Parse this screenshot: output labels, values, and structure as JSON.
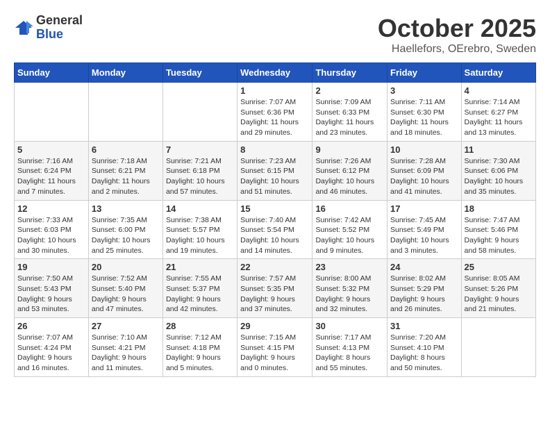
{
  "header": {
    "logo_general": "General",
    "logo_blue": "Blue",
    "month": "October 2025",
    "location": "Haellefors, OErebro, Sweden"
  },
  "days_of_week": [
    "Sunday",
    "Monday",
    "Tuesday",
    "Wednesday",
    "Thursday",
    "Friday",
    "Saturday"
  ],
  "weeks": [
    [
      {
        "day": "",
        "info": ""
      },
      {
        "day": "",
        "info": ""
      },
      {
        "day": "",
        "info": ""
      },
      {
        "day": "1",
        "info": "Sunrise: 7:07 AM\nSunset: 6:36 PM\nDaylight: 11 hours\nand 29 minutes."
      },
      {
        "day": "2",
        "info": "Sunrise: 7:09 AM\nSunset: 6:33 PM\nDaylight: 11 hours\nand 23 minutes."
      },
      {
        "day": "3",
        "info": "Sunrise: 7:11 AM\nSunset: 6:30 PM\nDaylight: 11 hours\nand 18 minutes."
      },
      {
        "day": "4",
        "info": "Sunrise: 7:14 AM\nSunset: 6:27 PM\nDaylight: 11 hours\nand 13 minutes."
      }
    ],
    [
      {
        "day": "5",
        "info": "Sunrise: 7:16 AM\nSunset: 6:24 PM\nDaylight: 11 hours\nand 7 minutes."
      },
      {
        "day": "6",
        "info": "Sunrise: 7:18 AM\nSunset: 6:21 PM\nDaylight: 11 hours\nand 2 minutes."
      },
      {
        "day": "7",
        "info": "Sunrise: 7:21 AM\nSunset: 6:18 PM\nDaylight: 10 hours\nand 57 minutes."
      },
      {
        "day": "8",
        "info": "Sunrise: 7:23 AM\nSunset: 6:15 PM\nDaylight: 10 hours\nand 51 minutes."
      },
      {
        "day": "9",
        "info": "Sunrise: 7:26 AM\nSunset: 6:12 PM\nDaylight: 10 hours\nand 46 minutes."
      },
      {
        "day": "10",
        "info": "Sunrise: 7:28 AM\nSunset: 6:09 PM\nDaylight: 10 hours\nand 41 minutes."
      },
      {
        "day": "11",
        "info": "Sunrise: 7:30 AM\nSunset: 6:06 PM\nDaylight: 10 hours\nand 35 minutes."
      }
    ],
    [
      {
        "day": "12",
        "info": "Sunrise: 7:33 AM\nSunset: 6:03 PM\nDaylight: 10 hours\nand 30 minutes."
      },
      {
        "day": "13",
        "info": "Sunrise: 7:35 AM\nSunset: 6:00 PM\nDaylight: 10 hours\nand 25 minutes."
      },
      {
        "day": "14",
        "info": "Sunrise: 7:38 AM\nSunset: 5:57 PM\nDaylight: 10 hours\nand 19 minutes."
      },
      {
        "day": "15",
        "info": "Sunrise: 7:40 AM\nSunset: 5:54 PM\nDaylight: 10 hours\nand 14 minutes."
      },
      {
        "day": "16",
        "info": "Sunrise: 7:42 AM\nSunset: 5:52 PM\nDaylight: 10 hours\nand 9 minutes."
      },
      {
        "day": "17",
        "info": "Sunrise: 7:45 AM\nSunset: 5:49 PM\nDaylight: 10 hours\nand 3 minutes."
      },
      {
        "day": "18",
        "info": "Sunrise: 7:47 AM\nSunset: 5:46 PM\nDaylight: 9 hours\nand 58 minutes."
      }
    ],
    [
      {
        "day": "19",
        "info": "Sunrise: 7:50 AM\nSunset: 5:43 PM\nDaylight: 9 hours\nand 53 minutes."
      },
      {
        "day": "20",
        "info": "Sunrise: 7:52 AM\nSunset: 5:40 PM\nDaylight: 9 hours\nand 47 minutes."
      },
      {
        "day": "21",
        "info": "Sunrise: 7:55 AM\nSunset: 5:37 PM\nDaylight: 9 hours\nand 42 minutes."
      },
      {
        "day": "22",
        "info": "Sunrise: 7:57 AM\nSunset: 5:35 PM\nDaylight: 9 hours\nand 37 minutes."
      },
      {
        "day": "23",
        "info": "Sunrise: 8:00 AM\nSunset: 5:32 PM\nDaylight: 9 hours\nand 32 minutes."
      },
      {
        "day": "24",
        "info": "Sunrise: 8:02 AM\nSunset: 5:29 PM\nDaylight: 9 hours\nand 26 minutes."
      },
      {
        "day": "25",
        "info": "Sunrise: 8:05 AM\nSunset: 5:26 PM\nDaylight: 9 hours\nand 21 minutes."
      }
    ],
    [
      {
        "day": "26",
        "info": "Sunrise: 7:07 AM\nSunset: 4:24 PM\nDaylight: 9 hours\nand 16 minutes."
      },
      {
        "day": "27",
        "info": "Sunrise: 7:10 AM\nSunset: 4:21 PM\nDaylight: 9 hours\nand 11 minutes."
      },
      {
        "day": "28",
        "info": "Sunrise: 7:12 AM\nSunset: 4:18 PM\nDaylight: 9 hours\nand 5 minutes."
      },
      {
        "day": "29",
        "info": "Sunrise: 7:15 AM\nSunset: 4:15 PM\nDaylight: 9 hours\nand 0 minutes."
      },
      {
        "day": "30",
        "info": "Sunrise: 7:17 AM\nSunset: 4:13 PM\nDaylight: 8 hours\nand 55 minutes."
      },
      {
        "day": "31",
        "info": "Sunrise: 7:20 AM\nSunset: 4:10 PM\nDaylight: 8 hours\nand 50 minutes."
      },
      {
        "day": "",
        "info": ""
      }
    ]
  ]
}
